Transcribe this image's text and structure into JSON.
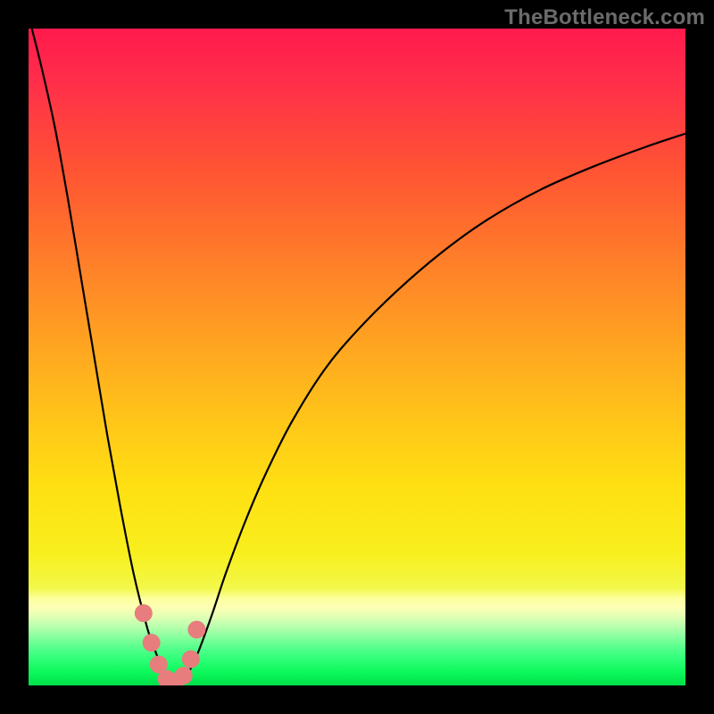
{
  "watermark": "TheBottleneck.com",
  "colors": {
    "frame": "#000000",
    "curve_stroke": "#000000",
    "marker_fill": "#e77d7d",
    "marker_stroke": "#b95858"
  },
  "chart_data": {
    "type": "line",
    "title": "",
    "xlabel": "",
    "ylabel": "",
    "xlim": [
      0,
      100
    ],
    "ylim": [
      0,
      100
    ],
    "description": "Bottleneck / mismatch curve. y is percentage mismatch (low = green/good, high = red/bad). Minimum near x≈22 where y≈0 (ideal match). Left branch rises steeply toward 100% as x→0; right branch rises asymptotically toward ~85-90% as x→100.",
    "series": [
      {
        "name": "bottleneck-curve",
        "x": [
          0.5,
          2,
          4,
          6,
          8,
          10,
          12,
          14,
          16,
          18,
          19,
          20,
          21,
          22,
          23,
          24,
          25,
          26,
          28,
          30,
          33,
          36,
          40,
          45,
          50,
          56,
          63,
          70,
          78,
          86,
          94,
          100
        ],
        "y": [
          100,
          94,
          85,
          74,
          62,
          50,
          38,
          27,
          17,
          9,
          6,
          3.5,
          1.5,
          0.4,
          0.4,
          1.4,
          3.2,
          5.5,
          11,
          17,
          25,
          32,
          40,
          48,
          54,
          60,
          66,
          71,
          75.5,
          79,
          82,
          84
        ]
      }
    ],
    "markers": {
      "description": "Highlighted chunky points around the minimum",
      "x": [
        17.5,
        18.7,
        19.8,
        21.0,
        22.3,
        23.6,
        24.7,
        25.6
      ],
      "y": [
        11.0,
        6.5,
        3.2,
        1.0,
        0.6,
        1.5,
        4.0,
        8.5
      ]
    },
    "gradient_bands": [
      {
        "y": 100,
        "color": "#ff1a4d"
      },
      {
        "y": 50,
        "color": "#ff9e22"
      },
      {
        "y": 20,
        "color": "#ffe012"
      },
      {
        "y": 12,
        "color": "#fdff9f"
      },
      {
        "y": 6,
        "color": "#7dff9a"
      },
      {
        "y": 0,
        "color": "#00e04b"
      }
    ]
  }
}
